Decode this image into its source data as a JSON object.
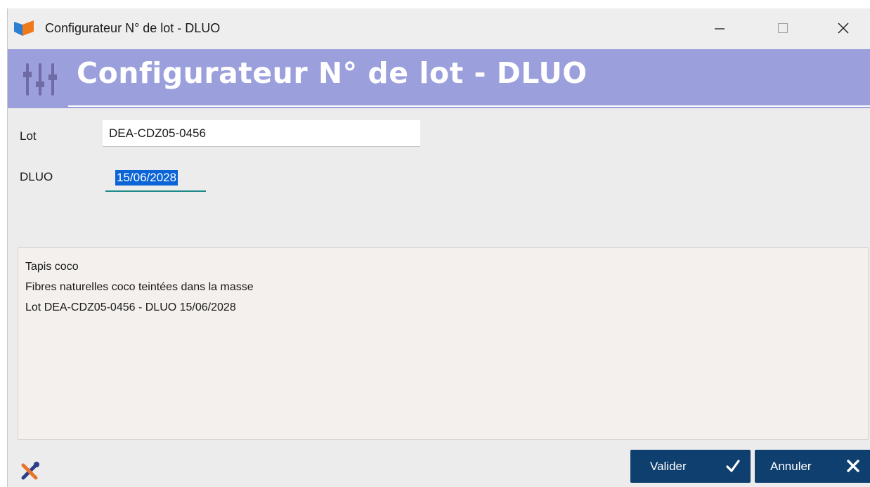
{
  "window": {
    "title": "Configurateur N° de lot - DLUO",
    "controls": {
      "minimize": "minimize-icon",
      "maximize": "maximize-icon",
      "close": "close-icon"
    }
  },
  "header": {
    "title": "Configurateur N° de lot - DLUO",
    "icon": "sliders-icon",
    "band_color": "#9b9fdc"
  },
  "form": {
    "lot": {
      "label": "Lot",
      "value": "DEA-CDZ05-0456"
    },
    "dluo": {
      "label": "DLUO",
      "value": "15/06/2028"
    }
  },
  "description": {
    "lines": [
      "Tapis coco",
      "Fibres naturelles coco teintées dans la masse",
      "Lot DEA-CDZ05-0456 - DLUO 15/06/2028"
    ]
  },
  "footer": {
    "tools_icon": "tools-icon",
    "valider_label": "Valider",
    "annuler_label": "Annuler",
    "button_color": "#0e3f6e"
  }
}
